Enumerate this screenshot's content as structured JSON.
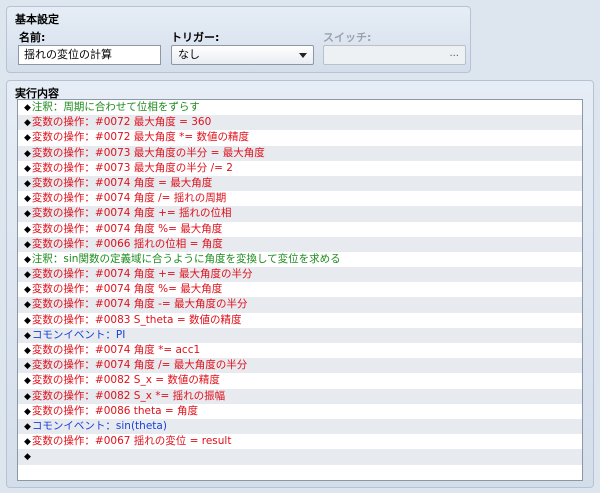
{
  "basic": {
    "title": "基本設定",
    "name_label": "名前:",
    "name_value": "揺れの変位の計算",
    "trigger_label": "トリガー:",
    "trigger_value": "なし",
    "switch_label": "スイッチ:",
    "switch_button": "..."
  },
  "exec": {
    "title": "実行内容",
    "rows": [
      {
        "kind": "comment",
        "text": "注釈：周期に合わせて位相をずらす"
      },
      {
        "kind": "var",
        "text": "変数の操作：#0072 最大角度 = 360"
      },
      {
        "kind": "var",
        "text": "変数の操作：#0072 最大角度 *= 数値の精度"
      },
      {
        "kind": "var",
        "text": "変数の操作：#0073 最大角度の半分 = 最大角度"
      },
      {
        "kind": "var",
        "text": "変数の操作：#0073 最大角度の半分 /= 2"
      },
      {
        "kind": "var",
        "text": "変数の操作：#0074 角度 = 最大角度"
      },
      {
        "kind": "var",
        "text": "変数の操作：#0074 角度 /= 揺れの周期"
      },
      {
        "kind": "var",
        "text": "変数の操作：#0074 角度 += 揺れの位相"
      },
      {
        "kind": "var",
        "text": "変数の操作：#0074 角度 %= 最大角度"
      },
      {
        "kind": "var",
        "text": "変数の操作：#0066 揺れの位相 = 角度"
      },
      {
        "kind": "comment",
        "text": "注釈：sin関数の定義域に合うように角度を変換して変位を求める"
      },
      {
        "kind": "var",
        "text": "変数の操作：#0074 角度 += 最大角度の半分"
      },
      {
        "kind": "var",
        "text": "変数の操作：#0074 角度 %= 最大角度"
      },
      {
        "kind": "var",
        "text": "変数の操作：#0074 角度 -= 最大角度の半分"
      },
      {
        "kind": "var",
        "text": "変数の操作：#0083 S_theta = 数値の精度"
      },
      {
        "kind": "common",
        "text": "コモンイベント：PI"
      },
      {
        "kind": "var",
        "text": "変数の操作：#0074 角度 *= acc1"
      },
      {
        "kind": "var",
        "text": "変数の操作：#0074 角度 /= 最大角度の半分"
      },
      {
        "kind": "var",
        "text": "変数の操作：#0082 S_x = 数値の精度"
      },
      {
        "kind": "var",
        "text": "変数の操作：#0082 S_x *= 揺れの振幅"
      },
      {
        "kind": "var",
        "text": "変数の操作：#0086 theta = 角度"
      },
      {
        "kind": "common",
        "text": "コモンイベント：sin(theta)"
      },
      {
        "kind": "var",
        "text": "変数の操作：#0067 揺れの変位 = result"
      },
      {
        "kind": "empty",
        "text": ""
      },
      {
        "kind": "blank",
        "text": ""
      },
      {
        "kind": "blank",
        "text": ""
      }
    ]
  },
  "colors": {
    "comment": "#1e8c1e",
    "var": "#e0101a",
    "common": "#1a3fd6"
  }
}
